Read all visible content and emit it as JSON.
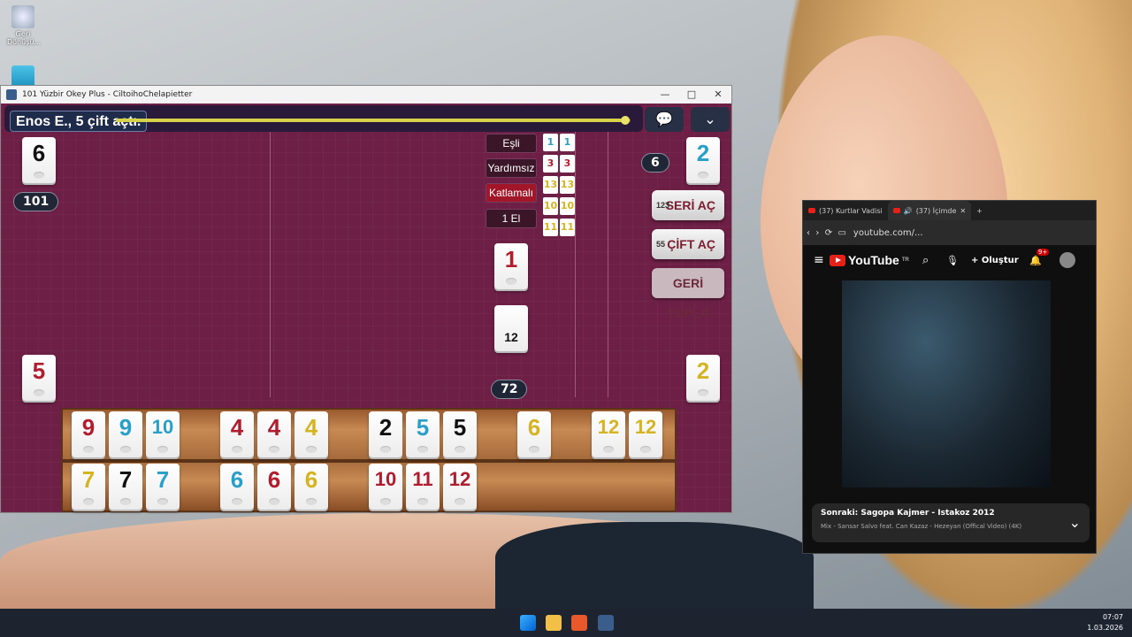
{
  "desktop": {
    "icons": [
      {
        "name": "recycle-bin",
        "label": "Geri Dönüşü..."
      },
      {
        "name": "app-shortcut",
        "label": ""
      }
    ]
  },
  "game_window": {
    "title": "101 Yüzbir Okey Plus - CiltoihoChelapietter",
    "announcement": "Enos E., 5 çift açtı.",
    "progress": 0.99,
    "players": {
      "top_left_tile": "6",
      "score": "101",
      "top_right_tile": "2",
      "right_badge": "6",
      "bottom_left_tile": "5",
      "bottom_right_tile": "2"
    },
    "options": [
      "Eşli",
      "Yardımsız",
      "Katlamalı",
      "1 El"
    ],
    "selected_option": "Katlamalı",
    "mini_tiles": [
      {
        "v": "1",
        "c": "blue"
      },
      {
        "v": "1",
        "c": "blue"
      },
      {
        "v": "3",
        "c": "red"
      },
      {
        "v": "3",
        "c": "red"
      },
      {
        "v": "13",
        "c": "yellow"
      },
      {
        "v": "13",
        "c": "yellow"
      },
      {
        "v": "10",
        "c": "yellow"
      },
      {
        "v": "10",
        "c": "yellow"
      },
      {
        "v": "11",
        "c": "yellow"
      },
      {
        "v": "11",
        "c": "yellow"
      }
    ],
    "indicator_tile": {
      "v": "1",
      "c": "red"
    },
    "center_tile": "12",
    "remaining": "72",
    "buttons": {
      "seri_ac": "SERİ AÇ",
      "cift_ac": "ÇİFT AÇ",
      "geri_topla": "GERİ TOPLA",
      "seri_icon": "123",
      "cift_icon": "55"
    },
    "rack_top": [
      {
        "v": "9",
        "c": "red"
      },
      {
        "v": "9",
        "c": "blue"
      },
      {
        "v": "10",
        "c": "blue"
      },
      null,
      {
        "v": "4",
        "c": "red"
      },
      {
        "v": "4",
        "c": "red"
      },
      {
        "v": "4",
        "c": "yellow"
      },
      null,
      {
        "v": "2",
        "c": "black"
      },
      {
        "v": "5",
        "c": "blue"
      },
      {
        "v": "5",
        "c": "black"
      },
      null,
      {
        "v": "6",
        "c": "yellow"
      },
      null,
      {
        "v": "12",
        "c": "yellow"
      },
      {
        "v": "12",
        "c": "yellow"
      }
    ],
    "rack_bottom": [
      {
        "v": "7",
        "c": "yellow"
      },
      {
        "v": "7",
        "c": "black"
      },
      {
        "v": "7",
        "c": "blue"
      },
      null,
      {
        "v": "6",
        "c": "blue"
      },
      {
        "v": "6",
        "c": "red"
      },
      {
        "v": "6",
        "c": "yellow"
      },
      null,
      {
        "v": "10",
        "c": "red"
      },
      {
        "v": "11",
        "c": "red"
      },
      {
        "v": "12",
        "c": "red"
      }
    ]
  },
  "browser": {
    "tabs": [
      {
        "label": "(37) Kurtlar Vadisi"
      },
      {
        "label": "(37) İçimde"
      }
    ],
    "url": "youtube.com/...",
    "logo": "YouTube",
    "region": "TR",
    "create_label": "Oluştur",
    "notif_count": "9+",
    "next_title": "Sonraki: Sagopa Kajmer - Istakoz 2012",
    "next_sub": "Mix - Sansar Salvo feat. Can Kazaz - Hezeyan (Offical Video) (4K)"
  },
  "taskbar": {
    "time": "07:07",
    "date": "1.03.2026"
  }
}
